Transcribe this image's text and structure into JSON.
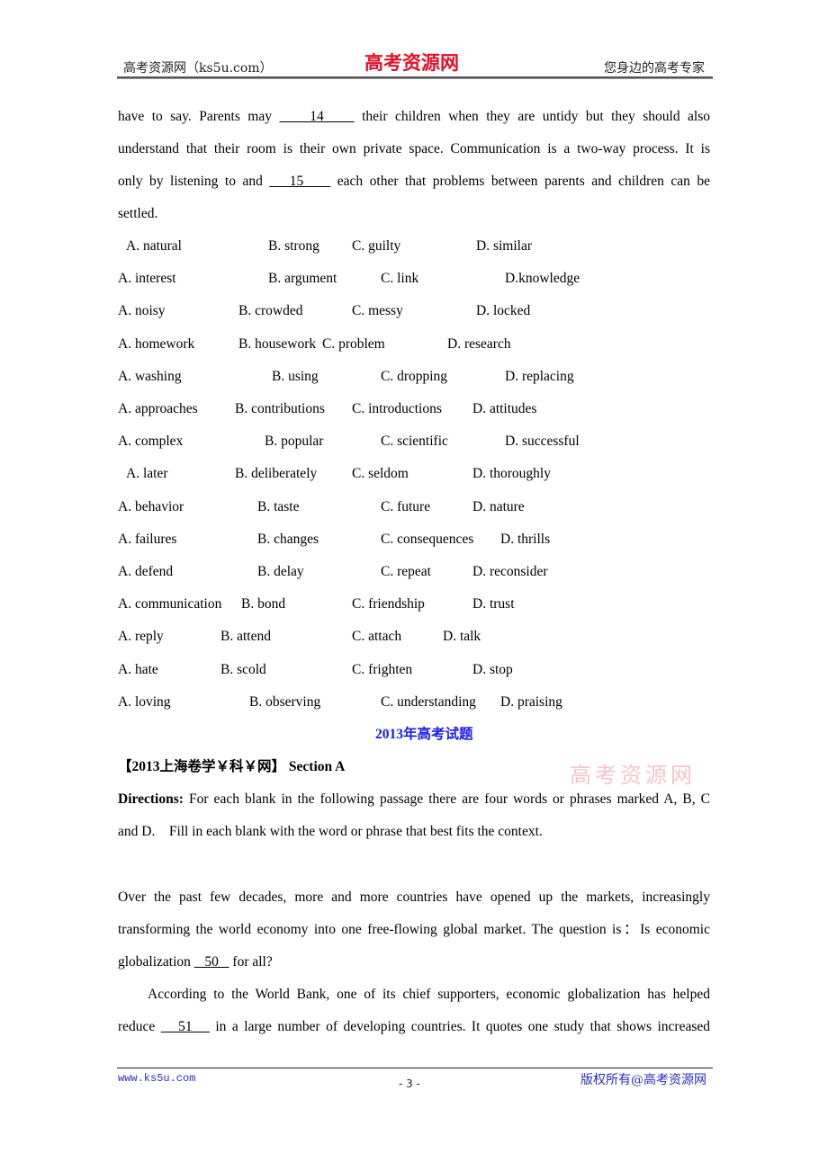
{
  "header": {
    "left": "高考资源网（ks5u.com）",
    "logo": "高考资源网",
    "right": "您身边的高考专家"
  },
  "passage1": {
    "line1_a": "have to say. Parents may",
    "blank14": "    14    ",
    "line1_b": "their children when they are untidy but they should also",
    "line2": "understand that their room is their own private space. Communication is a two-way process. It is",
    "line3_a": "only by listening to and",
    "blank15": "   15    ",
    "line3_b": "each other that problems between parents and children can be",
    "line4": "settled."
  },
  "options": [
    {
      "A": "A. natural",
      "B": "B. strong",
      "C": "C. guilty",
      "D": "D. similar"
    },
    {
      "A": "A. interest",
      "B": "B. argument",
      "C": "C. link",
      "D": "D.knowledge"
    },
    {
      "A": "A. noisy",
      "B": "B. crowded",
      "C": "C. messy",
      "D": "D. locked"
    },
    {
      "A": "A. homework",
      "B": "B. housework",
      "C": "C. problem",
      "D": "D. research"
    },
    {
      "A": "A. washing",
      "B": "B. using",
      "C": "C. dropping",
      "D": "D. replacing"
    },
    {
      "A": "A. approaches",
      "B": "B. contributions",
      "C": "C. introductions",
      "D": "D. attitudes"
    },
    {
      "A": "A. complex",
      "B": "B. popular",
      "C": "C. scientific",
      "D": "D. successful"
    },
    {
      "A": "A. later",
      "B": "B. deliberately",
      "C": "C. seldom",
      "D": "D. thoroughly"
    },
    {
      "A": "A. behavior",
      "B": "B. taste",
      "C": "C. future",
      "D": "D. nature"
    },
    {
      "A": "A. failures",
      "B": "B. changes",
      "C": "C. consequences",
      "D": "D. thrills"
    },
    {
      "A": "A. defend",
      "B": "B. delay",
      "C": "C. repeat",
      "D": "D. reconsider"
    },
    {
      "A": "A. communication",
      "B": "B. bond",
      "C": "C. friendship",
      "D": "D. trust"
    },
    {
      "A": "A. reply",
      "B": "B. attend",
      "C": "C. attach",
      "D": "D. talk"
    },
    {
      "A": "A. hate",
      "B": "B. scold",
      "C": "C. frighten",
      "D": "D. stop"
    },
    {
      "A": "A. loving",
      "B": "B. observing",
      "C": "C. understanding",
      "D": "D. praising"
    }
  ],
  "section_heading": "2013年高考试题",
  "source_heading": {
    "bracket_open": "【",
    "label": "2013上海卷学￥科￥网",
    "bracket_close": "】",
    "section": "Section A"
  },
  "watermark": "高考资源网",
  "directions": {
    "label": "Directions:",
    "line1": "For each blank in the following passage there are four words or phrases marked A, B, C",
    "line2": "and D.    Fill in each blank with the word or phrase that best fits the context."
  },
  "passage2": {
    "line1": "Over the past few decades, more and more countries have opened up the markets, increasingly",
    "line2": "transforming the world economy into one free-flowing global market. The question is：Is economic",
    "line3_a": "globalization",
    "blank50": "   50   ",
    "line3_b": "for all?",
    "line4": "According to the World Bank, one of its chief supporters, economic globalization has helped",
    "line5_a": "reduce",
    "blank51": "   51   ",
    "line5_b": "in a large number of developing countries. It quotes one study that shows increased"
  },
  "footer": {
    "left": "www.ks5u.com",
    "page": "- 3 -",
    "right": "版权所有@高考资源网"
  }
}
